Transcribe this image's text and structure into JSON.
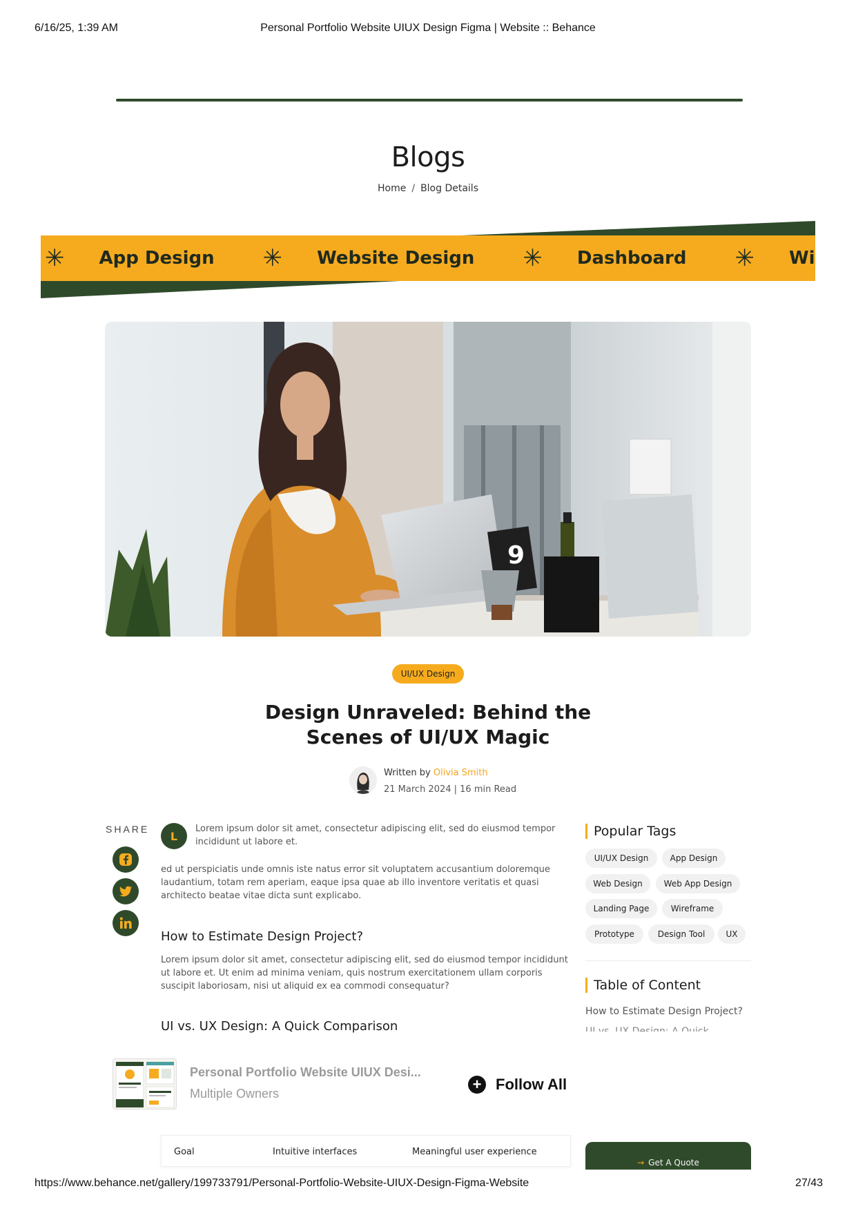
{
  "print_header": {
    "datetime": "6/16/25, 1:39 AM",
    "title": "Personal Portfolio Website UIUX Design Figma | Website :: Behance"
  },
  "print_footer": {
    "url": "https://www.behance.net/gallery/199733791/Personal-Portfolio-Website-UIUX-Design-Figma-Website",
    "page": "27/43"
  },
  "hero_section": {
    "title": "Blogs",
    "breadcrumb": {
      "home": "Home",
      "separator": "/",
      "current": "Blog Details"
    }
  },
  "marquee": {
    "star_glyph": "✳",
    "items": [
      "App Design",
      "Website Design",
      "Dashboard",
      "Wirefr"
    ]
  },
  "article": {
    "category": "UI/UX Design",
    "title_line1": "Design Unraveled: Behind the",
    "title_line2": "Scenes of UI/UX Magic",
    "written_by": "Written by",
    "author": "Olivia Smith",
    "date_read": "21 March 2024 | 16 min Read",
    "share_label": "SHARE",
    "intro_initial": "L",
    "intro_text": "Lorem ipsum dolor sit amet, consectetur adipiscing elit, sed do eiusmod tempor incididunt ut labore et.",
    "paragraph_1": "ed ut perspiciatis unde omnis iste natus error sit voluptatem accusantium doloremque laudantium, totam rem aperiam, eaque ipsa quae ab illo inventore veritatis et quasi architecto beatae vitae dicta sunt explicabo.",
    "heading_1": "How to Estimate Design Project?",
    "paragraph_2": "Lorem ipsum dolor sit amet, consectetur adipiscing elit, sed do eiusmod tempor incididunt ut labore et. Ut enim ad minima veniam, quis nostrum exercitationem ullam corporis suscipit laboriosam, nisi ut aliquid ex ea commodi consequatur?",
    "heading_2": "UI vs. UX Design: A Quick Comparison"
  },
  "sidebar": {
    "popular_tags_title": "Popular Tags",
    "tags": [
      "UI/UX Design",
      "App Design",
      "Web Design",
      "Web App Design",
      "Landing Page",
      "Wireframe",
      "Prototype",
      "Design Tool",
      "UX"
    ],
    "toc_title": "Table of Content",
    "toc_items": [
      "How to Estimate Design Project?",
      "UI vs. UX Design: A Quick"
    ]
  },
  "owner_bar": {
    "project_title": "Personal Portfolio Website UIUX Desi...",
    "owners": "Multiple Owners",
    "follow_label": "Follow All"
  },
  "bottom": {
    "tabs": [
      "Goal",
      "Intuitive interfaces",
      "Meaningful user experience"
    ],
    "quote_button": "Get A Quote",
    "quote_arrow": "→"
  },
  "colors": {
    "accent_yellow": "#f6ab1f",
    "brand_green": "#2f4a2b",
    "author_highlight": "#f2a51e"
  }
}
